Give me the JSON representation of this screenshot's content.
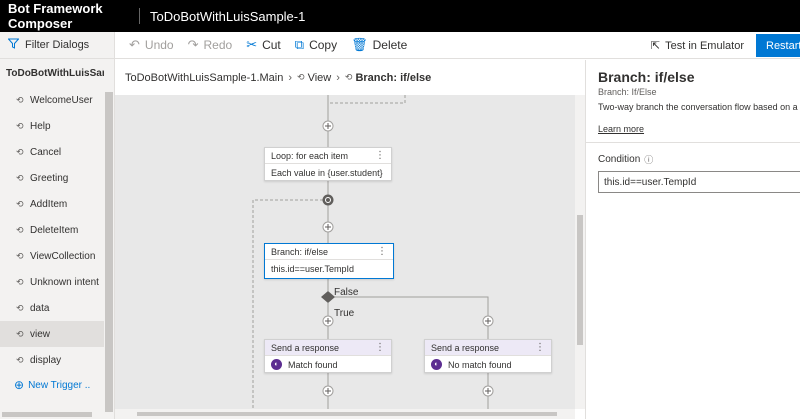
{
  "app": {
    "title": "Bot Framework Composer",
    "project": "ToDoBotWithLuisSample-1"
  },
  "sidebar": {
    "filter": "Filter Dialogs",
    "root": "ToDoBotWithLuisSam...",
    "items": [
      {
        "label": "WelcomeUser"
      },
      {
        "label": "Help"
      },
      {
        "label": "Cancel"
      },
      {
        "label": "Greeting"
      },
      {
        "label": "AddItem"
      },
      {
        "label": "DeleteItem"
      },
      {
        "label": "ViewCollection"
      },
      {
        "label": "Unknown intent"
      },
      {
        "label": "data"
      },
      {
        "label": "view"
      },
      {
        "label": "display"
      }
    ],
    "new_trigger": "New Trigger ..",
    "selected": "view"
  },
  "toolbar": {
    "undo": "Undo",
    "redo": "Redo",
    "cut": "Cut",
    "copy": "Copy",
    "delete": "Delete",
    "test": "Test in Emulator",
    "restart": "Restart"
  },
  "breadcrumb": {
    "items": [
      "ToDoBotWithLuisSample-1.Main",
      "View",
      "Branch: if/else"
    ]
  },
  "canvas": {
    "loop": {
      "title": "Loop: for each item",
      "body": "Each value in {user.student}"
    },
    "branch": {
      "title": "Branch: if/else",
      "body": "this.id==user.TempId"
    },
    "false_label": "False",
    "true_label": "True",
    "response_left": {
      "title": "Send a response",
      "body": "Match found"
    },
    "response_right": {
      "title": "Send a response",
      "body": "No match found"
    }
  },
  "panel": {
    "title": "Branch: if/else",
    "subtitle": "Branch: If/Else",
    "description": "Two-way branch the conversation flow based on a condition",
    "learn_more": "Learn more",
    "condition_label": "Condition",
    "condition_value": "this.id==user.TempId"
  },
  "colors": {
    "accent": "#0078d4",
    "topbar": "#000000",
    "canvas": "#e8e8e8",
    "response_header": "#ede9f6"
  }
}
